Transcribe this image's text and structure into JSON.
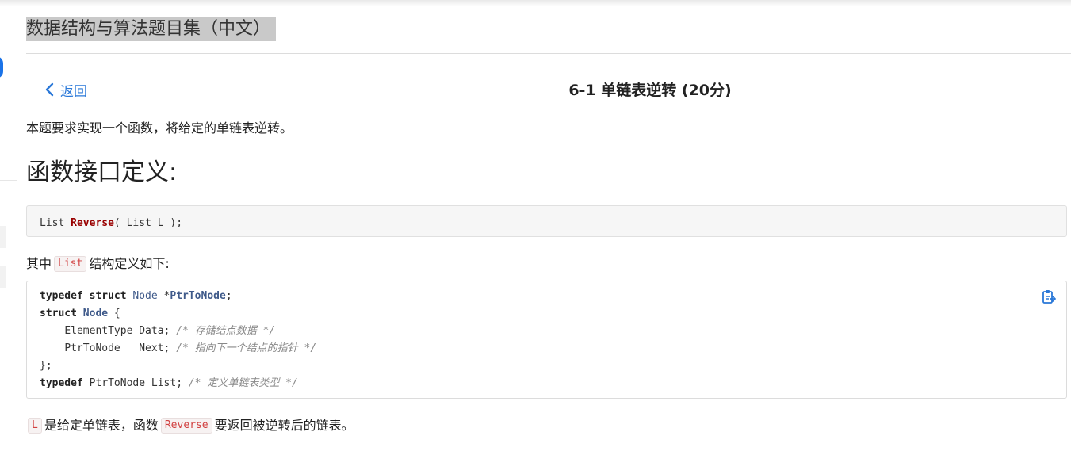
{
  "header": {
    "site_title": "数据结构与算法题目集（中文）"
  },
  "nav": {
    "back_label": "返回"
  },
  "problem": {
    "title": "6-1 单链表逆转 (20分)",
    "intro": "本题要求实现一个函数，将给定的单链表逆转。",
    "interface_heading": "函数接口定义:",
    "signature": {
      "ret_type": "List",
      "func_name": "Reverse",
      "params": "( List L );"
    },
    "struct_intro": {
      "prefix": "其中",
      "code": "List",
      "suffix": "结构定义如下:"
    },
    "struct_code": {
      "line1": {
        "kw": "typedef struct",
        "type": "Node",
        "star": "*",
        "name": "PtrToNode",
        "end": ";"
      },
      "line2": {
        "kw": "struct",
        "type": "Node",
        "end": " {"
      },
      "line3": {
        "indent": "    ",
        "text": "ElementType Data; ",
        "comment": "/* 存储结点数据 */"
      },
      "line4": {
        "indent": "    ",
        "text": "PtrToNode   Next; ",
        "comment": "/* 指向下一个结点的指针 */"
      },
      "line5": {
        "text": "};"
      },
      "line6": {
        "kw": "typedef",
        "text": " PtrToNode List; ",
        "comment": "/* 定义单链表类型 */"
      }
    },
    "final_line": {
      "code1": "L",
      "text1": "是给定单链表，函数",
      "code2": "Reverse",
      "text2": "要返回被逆转后的链表。"
    }
  },
  "icons": {
    "back": "chevron-left-icon",
    "copy": "copy-code-icon"
  },
  "colors": {
    "accent": "#2a78d8",
    "function_name": "#990000",
    "inline_code": "#d14040",
    "title_highlight": "#c9c9c9"
  }
}
